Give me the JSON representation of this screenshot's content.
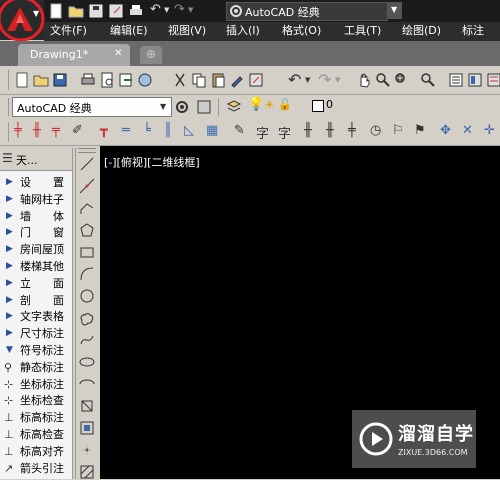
{
  "app": {
    "workspace_label": "AutoCAD 经典",
    "document_tab": "Drawing1*",
    "document_tab_close": "✕"
  },
  "menu": {
    "items": [
      "文件(F)",
      "编辑(E)",
      "视图(V)",
      "插入(I)",
      "格式(O)",
      "工具(T)",
      "绘图(D)",
      "标注"
    ]
  },
  "toolbar2": {
    "workspace_value": "AutoCAD 经典"
  },
  "layer_toolbar": {
    "layer_value": "0"
  },
  "side_panel": {
    "header": "天...",
    "items": [
      {
        "label": "设　　置",
        "icon": "triangle"
      },
      {
        "label": "轴网柱子",
        "icon": "triangle"
      },
      {
        "label": "墙　　体",
        "icon": "triangle"
      },
      {
        "label": "门　　窗",
        "icon": "triangle"
      },
      {
        "label": "房间屋顶",
        "icon": "triangle"
      },
      {
        "label": "楼梯其他",
        "icon": "triangle"
      },
      {
        "label": "立　　面",
        "icon": "triangle"
      },
      {
        "label": "剖　　面",
        "icon": "triangle"
      },
      {
        "label": "文字表格",
        "icon": "triangle"
      },
      {
        "label": "尺寸标注",
        "icon": "triangle"
      },
      {
        "label": "符号标注",
        "icon": "triangle-down"
      },
      {
        "label": "静态标注",
        "icon": "pin-icon"
      },
      {
        "label": "坐标标注",
        "icon": "coord-icon"
      },
      {
        "label": "坐标检查",
        "icon": "coord-check-icon"
      },
      {
        "label": "标高标注",
        "icon": "elev-icon"
      },
      {
        "label": "标高检查",
        "icon": "elev-check-icon"
      },
      {
        "label": "标高对齐",
        "icon": "elev-align-icon"
      },
      {
        "label": "箭头引注",
        "icon": "arrow-icon"
      }
    ]
  },
  "canvas": {
    "viewport_label": "[-][俯视][二维线框]"
  },
  "watermark": {
    "brand": "溜溜自学",
    "url": "ZIXUE.3D66.COM"
  },
  "colors": {
    "titlebar": "#1b1b1b",
    "menubar": "#2d2d2d",
    "toolbar": "#d4d0c8",
    "canvas": "#000000",
    "highlight_circle": "#e8202a",
    "watermark_bg": "#5a5a5a"
  }
}
